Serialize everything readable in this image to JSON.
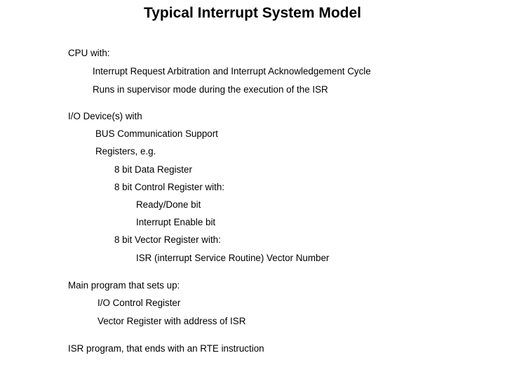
{
  "slide": {
    "title": "Typical Interrupt System Model",
    "sections": {
      "cpu": {
        "heading": "CPU with:",
        "items": [
          "Interrupt Request Arbitration and Interrupt Acknowledgement Cycle",
          "Runs in supervisor mode during the execution of the ISR"
        ]
      },
      "io_device": {
        "heading": "I/O Device(s) with",
        "items": [
          "BUS Communication Support",
          "Registers, e.g."
        ],
        "registers": [
          "8 bit Data Register",
          "8 bit Control Register with:",
          "8 bit Vector Register with:"
        ],
        "control_register_bits": [
          "Ready/Done bit",
          "Interrupt Enable bit"
        ],
        "vector_register_items": [
          "ISR (interrupt Service Routine) Vector Number"
        ]
      },
      "main_program": {
        "heading": "Main program that sets up:",
        "items": [
          "I/O Control Register",
          "Vector Register with address of ISR"
        ]
      },
      "isr_program": {
        "heading": "ISR program, that ends with an RTE instruction"
      }
    }
  }
}
